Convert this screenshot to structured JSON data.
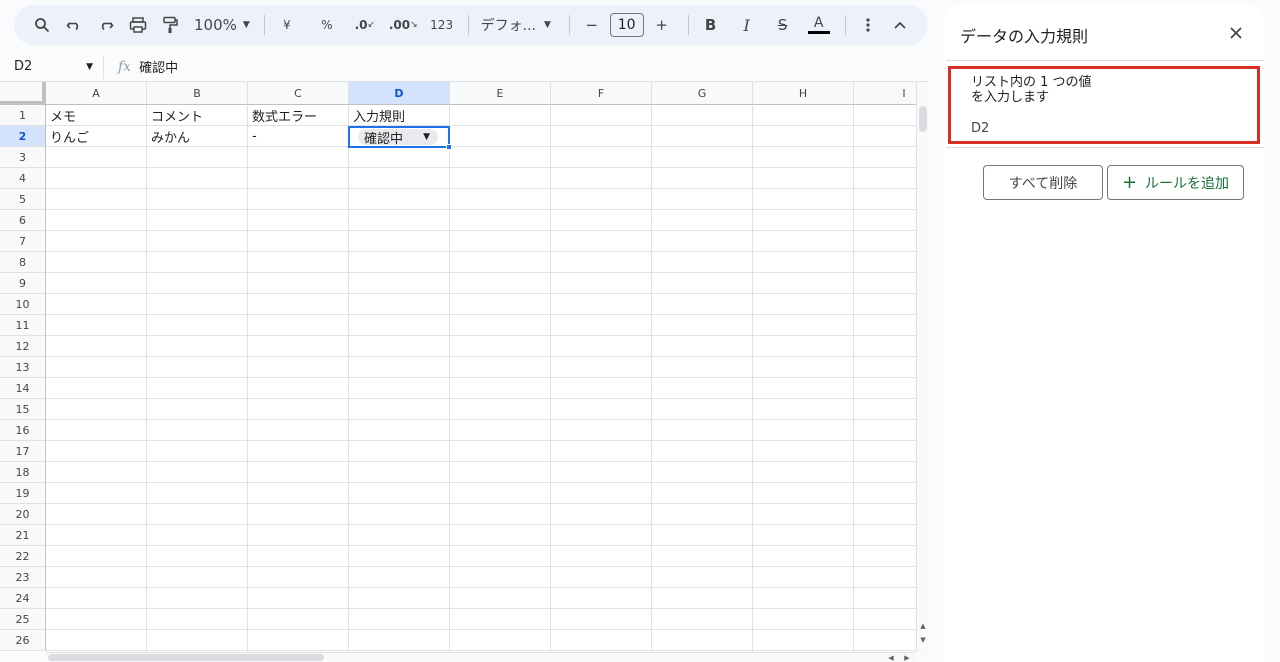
{
  "toolbar": {
    "zoom": "100%",
    "currency": "¥",
    "percent": "%",
    "decrease_decimal": ".0",
    "increase_decimal": ".00",
    "number_format": "123",
    "font": "デフォ...",
    "font_size": "10",
    "bold": "B",
    "italic": "I",
    "strikethrough": "S",
    "text_color": "A",
    "minus": "−",
    "plus": "+"
  },
  "formula_bar": {
    "name_box": "D2",
    "fx": "fx",
    "value": "確認中"
  },
  "sheet": {
    "columns": [
      "A",
      "B",
      "C",
      "D",
      "E",
      "F",
      "G",
      "H",
      "I"
    ],
    "rows": [
      "1",
      "2",
      "3",
      "4",
      "5",
      "6",
      "7",
      "8",
      "9",
      "10",
      "11",
      "12",
      "13",
      "14",
      "15",
      "16",
      "17",
      "18",
      "19",
      "20",
      "21",
      "22",
      "23",
      "24",
      "25",
      "26"
    ],
    "cells": {
      "A1": "メモ",
      "B1": "コメント",
      "C1": "数式エラー",
      "D1": "入力規則",
      "A2": "りんご",
      "B2": "みかん",
      "C2": "-",
      "D2": "確認中"
    },
    "selected_cell": "D2"
  },
  "side_panel": {
    "title": "データの入力規則",
    "rule": {
      "title_line1": "リスト内の 1 つの値",
      "title_line2": "を入力します",
      "range": "D2"
    },
    "delete_all_label": "すべて削除",
    "add_rule_label": "ルールを追加",
    "accent_color": "#137333",
    "highlight_color": "#d93025"
  }
}
